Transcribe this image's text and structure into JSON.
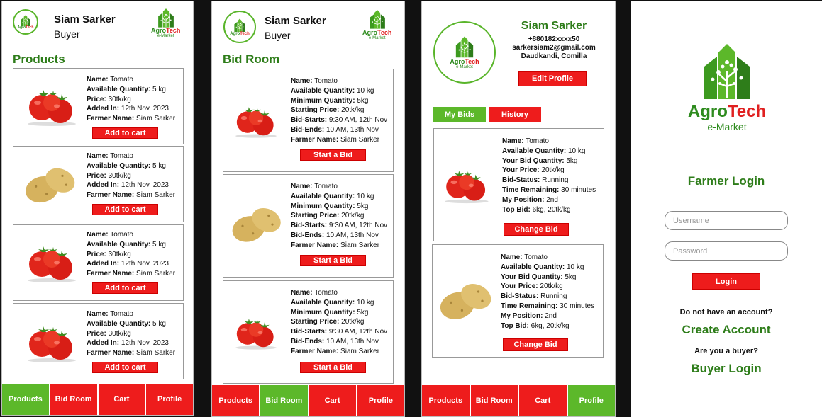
{
  "header": {
    "name": "Siam Sarker",
    "role": "Buyer"
  },
  "logo": {
    "agro": "Agro",
    "tech": "Tech",
    "sub": "e-Market"
  },
  "products": {
    "title": "Products",
    "items": [
      {
        "img": "tomato",
        "name": "Tomato",
        "qty": "5 kg",
        "price": "30tk/kg",
        "added": "12th Nov, 2023",
        "farmer": "Siam Sarker",
        "button": "Add to cart"
      },
      {
        "img": "potato",
        "name": "Tomato",
        "qty": "5 kg",
        "price": "30tk/kg",
        "added": "12th Nov, 2023",
        "farmer": "Siam Sarker",
        "button": "Add to cart"
      },
      {
        "img": "tomato",
        "name": "Tomato",
        "qty": "5 kg",
        "price": "30tk/kg",
        "added": "12th Nov, 2023",
        "farmer": "Siam Sarker",
        "button": "Add to cart"
      },
      {
        "img": "tomato",
        "name": "Tomato",
        "qty": "5 kg",
        "price": "30tk/kg",
        "added": "12th Nov, 2023",
        "farmer": "Siam Sarker",
        "button": "Add to cart"
      }
    ]
  },
  "labels": {
    "name": "Name:",
    "qty": "Available Quantity:",
    "price": "Price:",
    "added": "Added In:",
    "farmer": "Farmer Name:",
    "min": "Minimum Quantity:",
    "start_price": "Starting Price:",
    "bid_starts": "Bid-Starts:",
    "bid_ends": "Bid-Ends:",
    "your_qty": "Your Bid Quantity:",
    "your_price": "Your Price:",
    "status": "Bid-Status:",
    "remaining": "Time Remaining:",
    "position": "My Position:",
    "top": "Top Bid:"
  },
  "bidroom": {
    "title": "Bid Room",
    "items": [
      {
        "img": "tomato",
        "name": "Tomato",
        "qty": "10 kg",
        "min": "5kg",
        "start_price": "20tk/kg",
        "bid_starts": "9:30 AM, 12th Nov",
        "bid_ends": "10 AM, 13th Nov",
        "farmer": "Siam Sarker",
        "button": "Start a Bid"
      },
      {
        "img": "potato",
        "name": "Tomato",
        "qty": "10 kg",
        "min": "5kg",
        "start_price": "20tk/kg",
        "bid_starts": "9:30 AM, 12th Nov",
        "bid_ends": "10 AM, 13th Nov",
        "farmer": "Siam Sarker",
        "button": "Start a Bid"
      },
      {
        "img": "tomato",
        "name": "Tomato",
        "qty": "10 kg",
        "min": "5kg",
        "start_price": "20tk/kg",
        "bid_starts": "9:30 AM, 12th Nov",
        "bid_ends": "10 AM, 13th Nov",
        "farmer": "Siam Sarker",
        "button": "Start a Bid"
      }
    ]
  },
  "profile": {
    "name": "Siam Sarker",
    "phone": "+880182xxxx50",
    "email": "sarkersiam2@gmail.com",
    "address": "Daudkandi, Comilla",
    "edit_button": "Edit Profile",
    "tabs": [
      "My Bids",
      "History"
    ],
    "bids": [
      {
        "img": "tomato",
        "name": "Tomato",
        "qty": "10 kg",
        "your_qty": "5kg",
        "your_price": "20tk/kg",
        "status": "Running",
        "remaining": "30 minutes",
        "position": "2nd",
        "top": "6kg, 20tk/kg",
        "button": "Change Bid"
      },
      {
        "img": "potato",
        "name": "Tomato",
        "qty": "10 kg",
        "your_qty": "5kg",
        "your_price": "20tk/kg",
        "status": "Running",
        "remaining": "30 minutes",
        "position": "2nd",
        "top": "6kg, 20tk/kg",
        "button": "Change Bid"
      }
    ]
  },
  "nav": [
    "Products",
    "Bid Room",
    "Cart",
    "Profile"
  ],
  "login": {
    "title": "Farmer Login",
    "username_placeholder": "Username",
    "password_placeholder": "Password",
    "button": "Login",
    "no_account": "Do not have an account?",
    "create": "Create Account",
    "buyer_q": "Are you a buyer?",
    "buyer_login": "Buyer Login"
  },
  "colors": {
    "green": "#5cb82a",
    "red": "#ee1c1c",
    "dark_green": "#2e7d1a"
  }
}
